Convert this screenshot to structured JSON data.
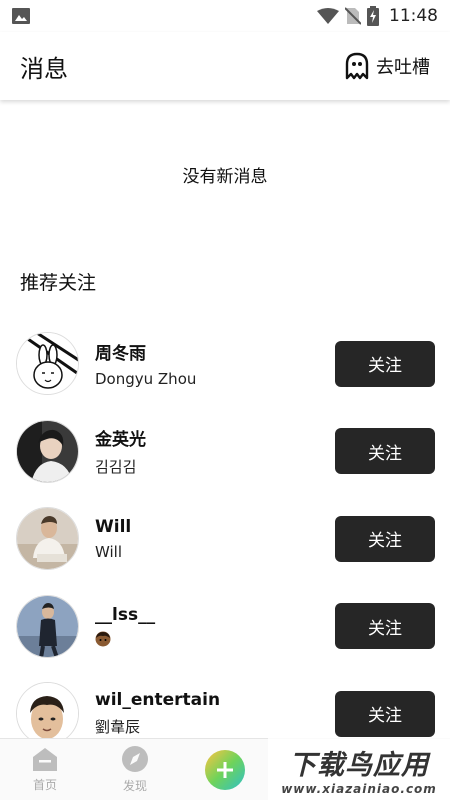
{
  "status_bar": {
    "time": "11:48",
    "icons": [
      "gallery-icon",
      "wifi-icon",
      "no-sim-icon",
      "battery-charging-icon"
    ]
  },
  "header": {
    "title": "消息",
    "complain_label": "去吐槽",
    "complain_icon": "ghost-icon"
  },
  "empty_state": "没有新消息",
  "recommend": {
    "title": "推荐关注",
    "users": [
      {
        "name": "周冬雨",
        "sub": "Dongyu Zhou",
        "follow_label": "关注"
      },
      {
        "name": "金英光",
        "sub": "김김김",
        "follow_label": "关注"
      },
      {
        "name": "Will",
        "sub": "Will",
        "follow_label": "关注"
      },
      {
        "name": "__lss__",
        "sub": "",
        "sub_icon": "face-emoji-icon",
        "follow_label": "关注"
      },
      {
        "name": "wil_entertain",
        "sub": "劉韋辰",
        "follow_label": "关注"
      }
    ]
  },
  "bottom_nav": {
    "items": [
      {
        "label": "首页",
        "icon": "home-icon"
      },
      {
        "label": "发现",
        "icon": "compass-icon"
      },
      {
        "label": "",
        "icon": "plus-icon"
      }
    ]
  },
  "watermark": {
    "main": "下载鸟应用",
    "sub": "www.xiazainiao.com"
  },
  "colors": {
    "follow_button_bg": "#262626",
    "follow_button_text": "#ffffff"
  }
}
